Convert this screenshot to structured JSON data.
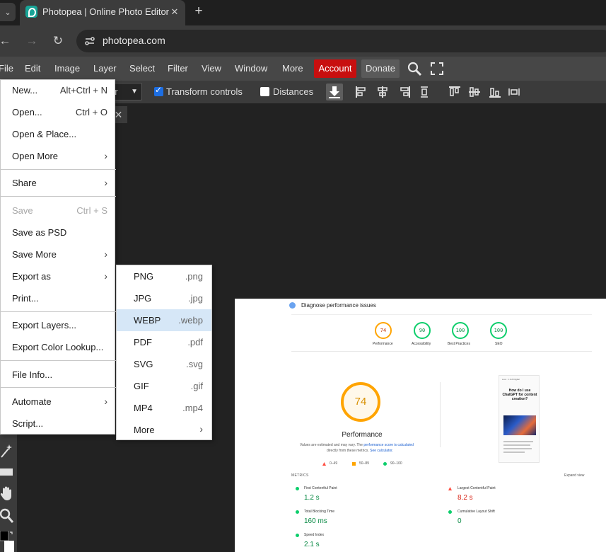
{
  "browser": {
    "tab_title": "Photopea | Online Photo Editor",
    "tab_close": "✕",
    "new_tab": "+",
    "url": "photopea.com",
    "tab_menu": "⌄"
  },
  "menubar": {
    "items": [
      "File",
      "Edit",
      "Image",
      "Layer",
      "Select",
      "Filter",
      "View",
      "Window",
      "More"
    ],
    "account": "Account",
    "donate": "Donate",
    "account_color": "#c80f0f"
  },
  "options": {
    "layer_select": "er",
    "transform_controls": "Transform controls",
    "distances": "Distances",
    "transform_checked": true,
    "distances_checked": false
  },
  "doc_tab_close": "✕",
  "file_menu": {
    "new": {
      "label": "New...",
      "shortcut": "Alt+Ctrl + N"
    },
    "open": {
      "label": "Open...",
      "shortcut": "Ctrl + O"
    },
    "open_place": {
      "label": "Open & Place..."
    },
    "open_more": {
      "label": "Open More"
    },
    "share": {
      "label": "Share"
    },
    "save": {
      "label": "Save",
      "shortcut": "Ctrl + S"
    },
    "save_psd": {
      "label": "Save as PSD"
    },
    "save_more": {
      "label": "Save More"
    },
    "export_as": {
      "label": "Export as"
    },
    "print": {
      "label": "Print..."
    },
    "export_layers": {
      "label": "Export Layers..."
    },
    "export_lookup": {
      "label": "Export Color Lookup..."
    },
    "file_info": {
      "label": "File Info..."
    },
    "automate": {
      "label": "Automate"
    },
    "script": {
      "label": "Script..."
    },
    "arrow": "›"
  },
  "export_menu": {
    "items": [
      {
        "label": "PNG",
        "ext": ".png"
      },
      {
        "label": "JPG",
        "ext": ".jpg"
      },
      {
        "label": "WEBP",
        "ext": ".webp"
      },
      {
        "label": "PDF",
        "ext": ".pdf"
      },
      {
        "label": "SVG",
        "ext": ".svg"
      },
      {
        "label": "GIF",
        "ext": ".gif"
      },
      {
        "label": "MP4",
        "ext": ".mp4"
      }
    ],
    "more": "More",
    "highlight_color": "#d6e7f7"
  },
  "lighthouse": {
    "header": "Diagnose performance issues",
    "scores": [
      {
        "value": "74",
        "label": "Performance"
      },
      {
        "value": "90",
        "label": "Accessibility"
      },
      {
        "value": "100",
        "label": "Best Practices"
      },
      {
        "value": "100",
        "label": "SEO"
      }
    ],
    "big_score": "74",
    "big_label": "Performance",
    "note_pre": "Values are estimated and may vary. The ",
    "note_link": "performance score is calculated",
    "note_post_1": "directly from these metrics. ",
    "note_link_2": "See calculator.",
    "legend": [
      "0–49",
      "50–89",
      "90–100"
    ],
    "phone_top": "ai.ai · 1 Job Digital",
    "phone_title": "How do I use ChatGPT for content creation?",
    "metrics_label": "METRICS",
    "expand_view": "Expand view",
    "metrics": {
      "fcp": {
        "name": "First Contentful Paint",
        "value": "1.2 s"
      },
      "lcp": {
        "name": "Largest Contentful Paint",
        "value": "8.2 s"
      },
      "tbt": {
        "name": "Total Blocking Time",
        "value": "160 ms"
      },
      "cls": {
        "name": "Cumulative Layout Shift",
        "value": "0"
      },
      "si": {
        "name": "Speed Index",
        "value": "2.1 s"
      }
    },
    "colors": {
      "good": "#0cce6b",
      "average": "#ffa400",
      "poor": "#ff4e42"
    }
  }
}
